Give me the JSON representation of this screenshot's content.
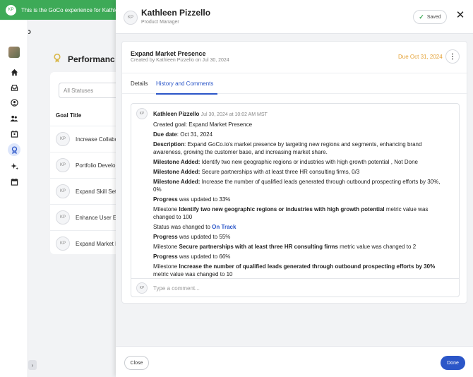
{
  "banner": {
    "avatar": "KP",
    "text": "This is the GoCo experience for Kathle"
  },
  "logo": {
    "part1": "Go",
    "part2": "Co"
  },
  "nav": {
    "icons": [
      "home-icon",
      "inbox-icon",
      "person-icon",
      "people-icon",
      "org-icon",
      "performance-icon",
      "sparkle-icon",
      "calendar-icon"
    ]
  },
  "background": {
    "page_title": "Performanc",
    "status_filter": "All Statuses",
    "goal_column": "Goal Title",
    "goals": [
      {
        "avatar": "KP",
        "title": "Increase Collabo"
      },
      {
        "avatar": "KP",
        "title": "Portfolio Develo"
      },
      {
        "avatar": "KP",
        "title": "Expand Skill Set"
      },
      {
        "avatar": "KP",
        "title": "Enhance User E"
      },
      {
        "avatar": "KP",
        "title": "Expand Market I"
      }
    ]
  },
  "drawer": {
    "avatar": "KP",
    "name": "Kathleen Pizzello",
    "role": "Product Manager",
    "saved_label": "Saved",
    "close_glyph": "✕",
    "goal": {
      "title": "Expand Market Presence",
      "created": "Created by Kathleen Pizzello on Jul 30, 2024",
      "due": "Due Oct 31, 2024",
      "more_glyph": "⋮"
    },
    "tabs": {
      "details": "Details",
      "history": "History and Comments"
    },
    "history": {
      "avatar": "KP",
      "author": "Kathleen Pizzello",
      "timestamp": "Jul 30, 2024 at 10:02 AM MST",
      "created_goal": "Created goal: Expand Market Presence",
      "due_label": "Due date",
      "due_value": ": Oct 31, 2024",
      "desc_label": "Description",
      "desc_value": ": Expand GoCo.io's market presence by targeting new regions and segments, enhancing brand awareness, growing the customer base, and increasing market share.",
      "ms1_label": "Milestone Added:",
      "ms1_value": " Identify two new geographic regions or industries with high growth potential , Not Done",
      "ms2_label": "Milestone Added:",
      "ms2_value": " Secure partnerships with at least three HR consulting firms, 0/3",
      "ms3_label": "Milestone Added:",
      "ms3_value": " Increase the number of qualified leads generated through outbound prospecting efforts by 30%, 0%",
      "p1_label": "Progress",
      "p1_value": " was updated to 33%",
      "m1_prefix": "Milestone ",
      "m1_name": "Identify two new geographic regions or industries with high growth potential",
      "m1_suffix": " metric value was changed to 100",
      "status_prefix": "Status was changed to ",
      "status_value": "On Track",
      "p2_label": "Progress",
      "p2_value": " was updated to 55%",
      "m2_prefix": "Milestone ",
      "m2_name": "Secure partnerships with at least three HR consulting firms",
      "m2_suffix": " metric value was changed to 2",
      "p3_label": "Progress",
      "p3_value": " was updated to 66%",
      "m3_prefix": "Milestone ",
      "m3_name": "Increase the number of qualified leads generated through outbound prospecting efforts by 30%",
      "m3_suffix": " metric value was changed to 10"
    },
    "comment": {
      "avatar": "KP",
      "placeholder": "Type a comment..."
    },
    "footer": {
      "close_label": "Close",
      "done_label": "Done"
    }
  },
  "colors": {
    "brand_green": "#3daa57",
    "accent_blue": "#2b56c8",
    "due_orange": "#e5a43b"
  }
}
